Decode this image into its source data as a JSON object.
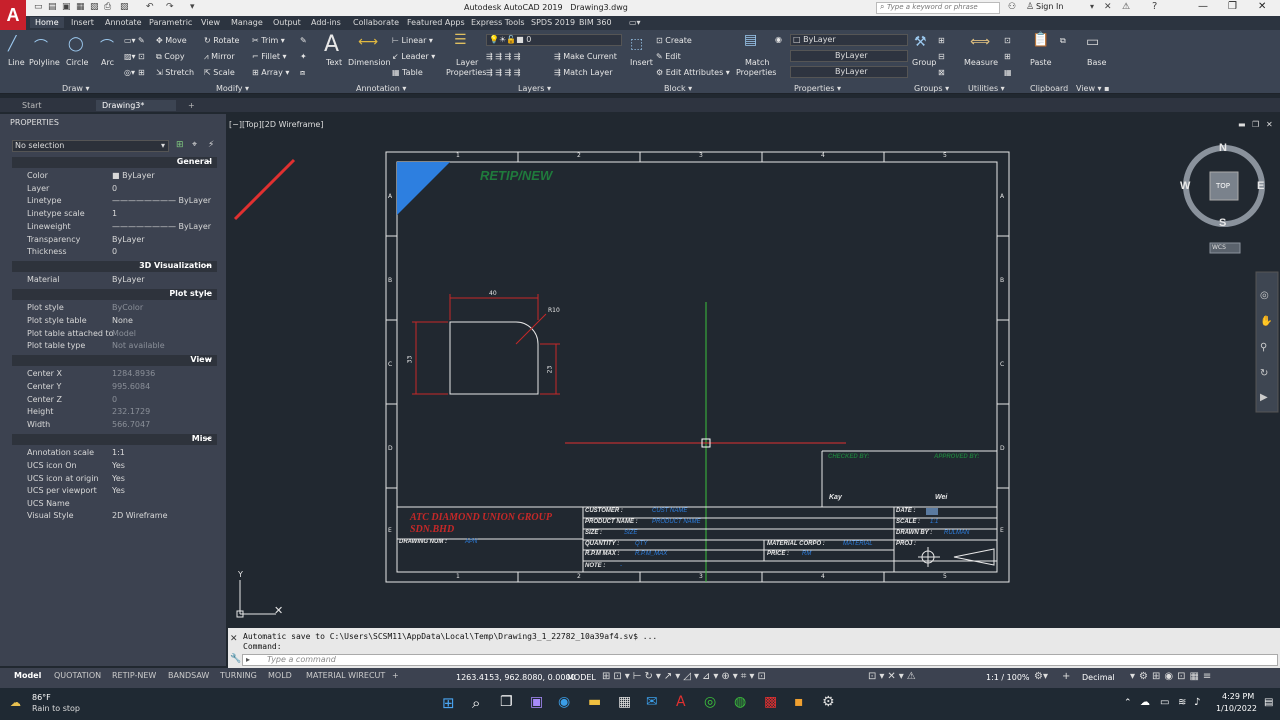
{
  "app": {
    "title": "Autodesk AutoCAD 2019",
    "file": "Drawing3.dwg",
    "search_placeholder": "Type a keyword or phrase",
    "sign_in": "Sign In"
  },
  "ribbon_tabs": [
    "Home",
    "Insert",
    "Annotate",
    "Parametric",
    "View",
    "Manage",
    "Output",
    "Add-ins",
    "Collaborate",
    "Featured Apps",
    "Express Tools",
    "SPDS 2019",
    "BIM 360"
  ],
  "ribbon": {
    "draw": {
      "line": "Line",
      "polyline": "Polyline",
      "circle": "Circle",
      "arc": "Arc",
      "label": "Draw"
    },
    "modify": {
      "move": "Move",
      "rotate": "Rotate",
      "trim": "Trim",
      "copy": "Copy",
      "mirror": "Mirror",
      "fillet": "Fillet",
      "stretch": "Stretch",
      "scale": "Scale",
      "array": "Array",
      "label": "Modify"
    },
    "annotation": {
      "text": "Text",
      "dimension": "Dimension",
      "linear": "Linear",
      "leader": "Leader",
      "table": "Table",
      "label": "Annotation"
    },
    "layers": {
      "layer_properties_1": "Layer",
      "layer_properties_2": "Properties",
      "current_layer": "0",
      "make_current": "Make Current",
      "match_layer": "Match Layer",
      "label": "Layers"
    },
    "block": {
      "insert": "Insert",
      "create": "Create",
      "edit": "Edit",
      "edit_attributes": "Edit Attributes",
      "label": "Block"
    },
    "properties": {
      "match_1": "Match",
      "match_2": "Properties",
      "color": "ByLayer",
      "linetype": "ByLayer",
      "lineweight": "ByLayer",
      "label": "Properties"
    },
    "groups": {
      "group": "Group",
      "label": "Groups"
    },
    "utilities": {
      "measure": "Measure",
      "label": "Utilities"
    },
    "clipboard": {
      "paste": "Paste",
      "label": "Clipboard"
    },
    "view": {
      "base": "Base",
      "label": "View"
    }
  },
  "doc_tabs": [
    "Start",
    "Drawing3*"
  ],
  "properties": {
    "title": "PROPERTIES",
    "selection": "No selection",
    "sections": {
      "general": "General",
      "viz3d": "3D Visualization",
      "plot": "Plot style",
      "view": "View",
      "misc": "Misc"
    },
    "general": [
      {
        "k": "Color",
        "v": "ByLayer"
      },
      {
        "k": "Layer",
        "v": "0"
      },
      {
        "k": "Linetype",
        "v": "ByLayer"
      },
      {
        "k": "Linetype scale",
        "v": "1"
      },
      {
        "k": "Lineweight",
        "v": "ByLayer"
      },
      {
        "k": "Transparency",
        "v": "ByLayer"
      },
      {
        "k": "Thickness",
        "v": "0"
      }
    ],
    "viz3d": [
      {
        "k": "Material",
        "v": "ByLayer"
      }
    ],
    "plot": [
      {
        "k": "Plot style",
        "v": "ByColor"
      },
      {
        "k": "Plot style table",
        "v": "None"
      },
      {
        "k": "Plot table attached to",
        "v": "Model"
      },
      {
        "k": "Plot table type",
        "v": "Not available"
      }
    ],
    "view": [
      {
        "k": "Center X",
        "v": "1284.8936"
      },
      {
        "k": "Center Y",
        "v": "995.6084"
      },
      {
        "k": "Center Z",
        "v": "0"
      },
      {
        "k": "Height",
        "v": "232.1729"
      },
      {
        "k": "Width",
        "v": "566.7047"
      }
    ],
    "misc": [
      {
        "k": "Annotation scale",
        "v": "1:1"
      },
      {
        "k": "UCS icon On",
        "v": "Yes"
      },
      {
        "k": "UCS icon at origin",
        "v": "Yes"
      },
      {
        "k": "UCS per viewport",
        "v": "Yes"
      },
      {
        "k": "UCS Name",
        "v": ""
      },
      {
        "k": "Visual Style",
        "v": "2D Wireframe"
      }
    ]
  },
  "viewport": {
    "label": "[−][Top][2D Wireframe]",
    "viewcube": {
      "n": "N",
      "s": "S",
      "e": "E",
      "w": "W",
      "top": "TOP",
      "wcs": "WCS"
    },
    "ucs_y": "Y"
  },
  "drawing": {
    "title": "RETIP/NEW",
    "company_1": "ATC DIAMOND UNION GROUP",
    "company_2": "SDN.BHD",
    "drawing_num_label": "DRAWING NUM :",
    "drawing_num": "APN",
    "checked_by": "CHECKED BY:",
    "approved_by": "APPROVED BY:",
    "checked_name": "Kay",
    "approved_name": "Wei",
    "customer_label": "CUSTOMER :",
    "customer": "CUST NAME",
    "product_label": "PRODUCT NAME :",
    "product": "PRODUCT NAME",
    "size_label": "SIZE :",
    "size": "SIZE",
    "quantity_label": "QUANTITY :",
    "quantity": "QTY",
    "rpm_label": "R.P.M MAX :",
    "rpm": "R.P.M_MAX",
    "note_label": "NOTE :",
    "note": "-",
    "material_label": "MATERIAL CORPO :",
    "material": "MATERIAL",
    "price_label": "PRICE :",
    "price": "RM",
    "date_label": "DATE :",
    "scale_label": "SCALE :",
    "scale": "1:1",
    "drawn_label": "DRAWN BY :",
    "drawn": "RULMAN",
    "proj_label": "PROJ :",
    "dim_width": "40",
    "dim_radius": "R10",
    "dim_height": "33",
    "dim_side": "23",
    "col_labels": [
      "1",
      "2",
      "3",
      "4",
      "5"
    ],
    "row_labels": [
      "A",
      "B",
      "C",
      "D",
      "E"
    ]
  },
  "command": {
    "history": "Automatic save to C:\\Users\\SCSM11\\AppData\\Local\\Temp\\Drawing3_1_22782_10a39af4.sv$ ...",
    "line": "Command:",
    "placeholder": "Type a command"
  },
  "layout_tabs": [
    "Model",
    "QUOTATION",
    "RETIP-NEW",
    "BANDSAW",
    "TURNING",
    "MOLD",
    "MATERIAL WIRECUT"
  ],
  "status": {
    "coords": "1263.4153, 962.8080, 0.0000",
    "mode": "MODEL",
    "scale": "1:1 / 100%",
    "units": "Decimal"
  },
  "taskbar": {
    "temp": "86°F",
    "weather": "Rain to stop",
    "time": "4:29 PM",
    "date": "1/10/2022"
  },
  "colors": {
    "accent": "#2f5aa0",
    "brand": "#c8202c",
    "drawing_green": "#1f7a3c",
    "drawing_red": "#c62828",
    "drawing_blue": "#2d7fe0"
  }
}
